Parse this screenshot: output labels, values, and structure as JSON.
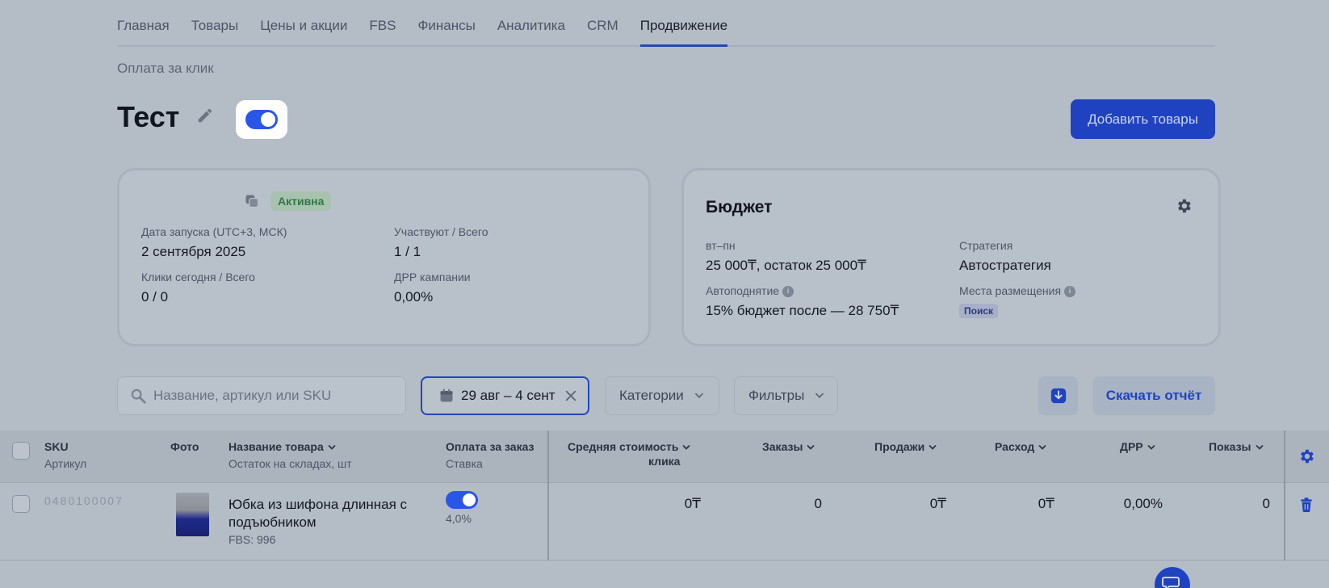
{
  "nav": {
    "items": [
      {
        "label": "Главная"
      },
      {
        "label": "Товары"
      },
      {
        "label": "Цены и акции"
      },
      {
        "label": "FBS"
      },
      {
        "label": "Финансы"
      },
      {
        "label": "Аналитика"
      },
      {
        "label": "CRM"
      },
      {
        "label": "Продвижение",
        "active": true
      }
    ]
  },
  "breadcrumb": "Оплата за клик",
  "campaign": {
    "title": "Тест",
    "enabled": true,
    "add_button": "Добавить товары"
  },
  "info_card": {
    "status": "Активна",
    "launch_label": "Дата запуска (UTC+3, МСК)",
    "launch_value": "2 сентября 2025",
    "participants_label": "Участвуют / Всего",
    "participants_value": "1 / 1",
    "clicks_label": "Клики сегодня / Всего",
    "clicks_value": "0 / 0",
    "drr_label": "ДРР кампании",
    "drr_value": "0,00%"
  },
  "budget_card": {
    "title": "Бюджет",
    "period_label": "вт–пн",
    "period_value": "25 000₸, остаток 25 000₸",
    "strategy_label": "Стратегия",
    "strategy_value": "Автостратегия",
    "autoraise_label": "Автоподнятие",
    "autoraise_value": "15% бюджет после — 28 750₸",
    "placement_label": "Места размещения",
    "placement_value": "Поиск"
  },
  "toolbar": {
    "search_placeholder": "Название, артикул или SKU",
    "date_range": "29 авг – 4 сент",
    "categories": "Категории",
    "filters": "Фильтры",
    "download": "Скачать отчёт"
  },
  "table": {
    "headers": {
      "sku": "SKU",
      "article": "Артикул",
      "photo": "Фото",
      "name": "Название товара",
      "stock": "Остаток на складах, шт",
      "pay_per_order": "Оплата за заказ",
      "bid": "Ставка",
      "avg_click_cost": "Средняя стоимость",
      "avg_click_cost_2": "клика",
      "orders": "Заказы",
      "sales": "Продажи",
      "spend": "Расход",
      "drr": "ДРР",
      "impressions": "Показы"
    },
    "rows": [
      {
        "sku": "0480100007",
        "name": "Юбка из шифона длинная с подъюбником",
        "stock": "FBS: 996",
        "pay_per_order_enabled": true,
        "bid": "4,0%",
        "avg_click_cost": "0₸",
        "orders": "0",
        "sales": "0₸",
        "spend": "0₸",
        "drr": "0,00%",
        "impressions": "0"
      }
    ]
  },
  "colors": {
    "accent": "#1f43c0",
    "toggle_on": "#2a56e8",
    "status_green": "#2e7a44"
  },
  "icons": [
    "edit-icon",
    "copy-icon",
    "gear-icon",
    "info-icon",
    "search-icon",
    "calendar-icon",
    "close-icon",
    "chevron-down-icon",
    "download-icon",
    "trash-icon",
    "chat-icon"
  ]
}
